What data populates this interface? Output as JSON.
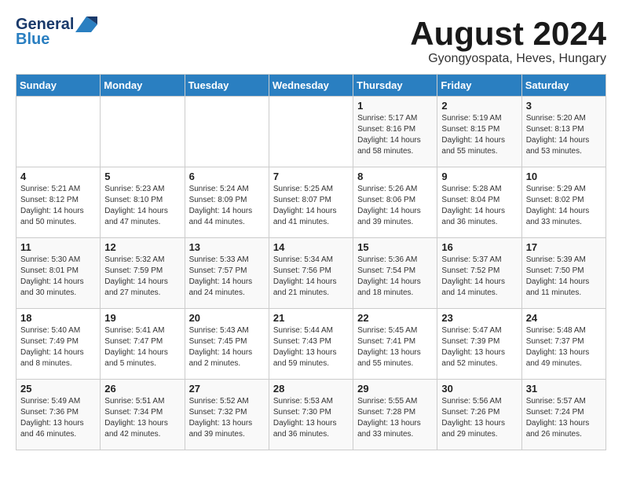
{
  "header": {
    "logo_general": "General",
    "logo_blue": "Blue",
    "month_title": "August 2024",
    "location": "Gyongyospata, Heves, Hungary"
  },
  "weekdays": [
    "Sunday",
    "Monday",
    "Tuesday",
    "Wednesday",
    "Thursday",
    "Friday",
    "Saturday"
  ],
  "weeks": [
    [
      {
        "day": "",
        "info": ""
      },
      {
        "day": "",
        "info": ""
      },
      {
        "day": "",
        "info": ""
      },
      {
        "day": "",
        "info": ""
      },
      {
        "day": "1",
        "info": "Sunrise: 5:17 AM\nSunset: 8:16 PM\nDaylight: 14 hours\nand 58 minutes."
      },
      {
        "day": "2",
        "info": "Sunrise: 5:19 AM\nSunset: 8:15 PM\nDaylight: 14 hours\nand 55 minutes."
      },
      {
        "day": "3",
        "info": "Sunrise: 5:20 AM\nSunset: 8:13 PM\nDaylight: 14 hours\nand 53 minutes."
      }
    ],
    [
      {
        "day": "4",
        "info": "Sunrise: 5:21 AM\nSunset: 8:12 PM\nDaylight: 14 hours\nand 50 minutes."
      },
      {
        "day": "5",
        "info": "Sunrise: 5:23 AM\nSunset: 8:10 PM\nDaylight: 14 hours\nand 47 minutes."
      },
      {
        "day": "6",
        "info": "Sunrise: 5:24 AM\nSunset: 8:09 PM\nDaylight: 14 hours\nand 44 minutes."
      },
      {
        "day": "7",
        "info": "Sunrise: 5:25 AM\nSunset: 8:07 PM\nDaylight: 14 hours\nand 41 minutes."
      },
      {
        "day": "8",
        "info": "Sunrise: 5:26 AM\nSunset: 8:06 PM\nDaylight: 14 hours\nand 39 minutes."
      },
      {
        "day": "9",
        "info": "Sunrise: 5:28 AM\nSunset: 8:04 PM\nDaylight: 14 hours\nand 36 minutes."
      },
      {
        "day": "10",
        "info": "Sunrise: 5:29 AM\nSunset: 8:02 PM\nDaylight: 14 hours\nand 33 minutes."
      }
    ],
    [
      {
        "day": "11",
        "info": "Sunrise: 5:30 AM\nSunset: 8:01 PM\nDaylight: 14 hours\nand 30 minutes."
      },
      {
        "day": "12",
        "info": "Sunrise: 5:32 AM\nSunset: 7:59 PM\nDaylight: 14 hours\nand 27 minutes."
      },
      {
        "day": "13",
        "info": "Sunrise: 5:33 AM\nSunset: 7:57 PM\nDaylight: 14 hours\nand 24 minutes."
      },
      {
        "day": "14",
        "info": "Sunrise: 5:34 AM\nSunset: 7:56 PM\nDaylight: 14 hours\nand 21 minutes."
      },
      {
        "day": "15",
        "info": "Sunrise: 5:36 AM\nSunset: 7:54 PM\nDaylight: 14 hours\nand 18 minutes."
      },
      {
        "day": "16",
        "info": "Sunrise: 5:37 AM\nSunset: 7:52 PM\nDaylight: 14 hours\nand 14 minutes."
      },
      {
        "day": "17",
        "info": "Sunrise: 5:39 AM\nSunset: 7:50 PM\nDaylight: 14 hours\nand 11 minutes."
      }
    ],
    [
      {
        "day": "18",
        "info": "Sunrise: 5:40 AM\nSunset: 7:49 PM\nDaylight: 14 hours\nand 8 minutes."
      },
      {
        "day": "19",
        "info": "Sunrise: 5:41 AM\nSunset: 7:47 PM\nDaylight: 14 hours\nand 5 minutes."
      },
      {
        "day": "20",
        "info": "Sunrise: 5:43 AM\nSunset: 7:45 PM\nDaylight: 14 hours\nand 2 minutes."
      },
      {
        "day": "21",
        "info": "Sunrise: 5:44 AM\nSunset: 7:43 PM\nDaylight: 13 hours\nand 59 minutes."
      },
      {
        "day": "22",
        "info": "Sunrise: 5:45 AM\nSunset: 7:41 PM\nDaylight: 13 hours\nand 55 minutes."
      },
      {
        "day": "23",
        "info": "Sunrise: 5:47 AM\nSunset: 7:39 PM\nDaylight: 13 hours\nand 52 minutes."
      },
      {
        "day": "24",
        "info": "Sunrise: 5:48 AM\nSunset: 7:37 PM\nDaylight: 13 hours\nand 49 minutes."
      }
    ],
    [
      {
        "day": "25",
        "info": "Sunrise: 5:49 AM\nSunset: 7:36 PM\nDaylight: 13 hours\nand 46 minutes."
      },
      {
        "day": "26",
        "info": "Sunrise: 5:51 AM\nSunset: 7:34 PM\nDaylight: 13 hours\nand 42 minutes."
      },
      {
        "day": "27",
        "info": "Sunrise: 5:52 AM\nSunset: 7:32 PM\nDaylight: 13 hours\nand 39 minutes."
      },
      {
        "day": "28",
        "info": "Sunrise: 5:53 AM\nSunset: 7:30 PM\nDaylight: 13 hours\nand 36 minutes."
      },
      {
        "day": "29",
        "info": "Sunrise: 5:55 AM\nSunset: 7:28 PM\nDaylight: 13 hours\nand 33 minutes."
      },
      {
        "day": "30",
        "info": "Sunrise: 5:56 AM\nSunset: 7:26 PM\nDaylight: 13 hours\nand 29 minutes."
      },
      {
        "day": "31",
        "info": "Sunrise: 5:57 AM\nSunset: 7:24 PM\nDaylight: 13 hours\nand 26 minutes."
      }
    ]
  ]
}
